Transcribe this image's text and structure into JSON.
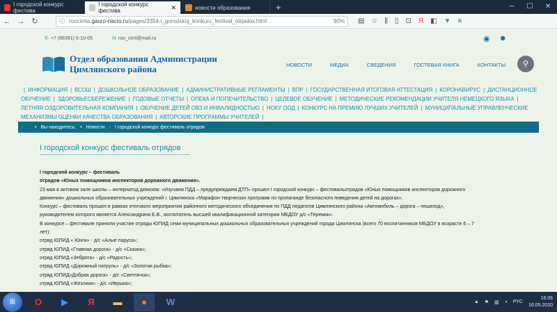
{
  "browser": {
    "tabs": [
      {
        "label": "I городской конкурс фестива",
        "active": false
      },
      {
        "label": "I городской конкурс фестива",
        "active": true
      },
      {
        "label": "новости образования",
        "active": false
      }
    ],
    "url_gray": "roocimla.",
    "url_main": "gauro-riacro.ru",
    "url_path": "/pages/3354-i_gorodskoj_konkurs_festival_otrjadov.html",
    "zoom": "90%"
  },
  "site": {
    "phone": "+7 (86391) 5-10-05",
    "email": "roo_ciml@mail.ru",
    "title_line1": "Отдел образования Администрации",
    "title_line2": "Цимлянского района",
    "nav": [
      "НОВОСТИ",
      "МЕДИА",
      "СВЕДЕНИЯ",
      "ГОСТЕВАЯ КНИГА",
      "КОНТАКТЫ"
    ],
    "topics": [
      "ИНФОРМАЦИЯ",
      "ВсОШ",
      "ДОШКОЛЬНОЕ ОБРАЗОВАНИЕ",
      "АДМИНИСТРАТИВНЫЕ РЕГЛАМЕНТЫ",
      "ВПР",
      "ГОСУДАРСТВЕННАЯ ИТОГОВАЯ АТТЕСТАЦИЯ",
      "КОРОНАВИРУС",
      "ДИСТАНЦИОННОЕ ОБУЧЕНИЕ",
      "ЗДОРОВЬЕСБЕРЕЖЕНИЕ",
      "ГОДОВЫЕ ОТЧЕТЫ",
      "ОПЕКА И ПОПЕЧИТЕЛЬСТВО",
      "ЦЕЛЕВОЕ ОБУЧЕНИЕ",
      "МЕТОДИЧЕСКИЕ РЕКОМЕНДАЦИИ УЧИТЕЛЯ НЕМЕЦКОГО ЯЗЫКА",
      "ЛЕТНЯЯ ОЗДОРОВИТЕЛЬНАЯ КОМПАНИЯ",
      "ОБУЧЕНИЕ ДЕТЕЙ ОВЗ И ИНВАЛИДНОСТЬЮ",
      "НОКУ ООД",
      "КОНКУРС НА ПРЕМИЮ ЛУЧШИХ УЧИТЕЛЕЙ",
      "МУНИЦИПАЛЬНЫЕ УПРАВЛЕНЧЕСКИЕ МЕХАНИЗМЫ ОЦЕНКИ КАЧЕСТВА ОБРАЗОВАНИЯ",
      "АВТОРСКИЕ ПРОГРАММЫ УЧИТЕЛЕЙ"
    ],
    "breadcrumb": [
      "Вы находитесь:",
      "Новости",
      "I городской конкурс фестиваль отрядов"
    ],
    "page_title": "I городской конкурс фестиваль отрядов",
    "article": [
      {
        "text": "I городской конкурс – фестиваль",
        "bold": true
      },
      {
        "text": "отрядов «Юных помощников инспекторов дорожного движения».",
        "bold": true
      },
      {
        "text": "23 мая в актовом зале школы – интернатод девизом: «Изучаем ПДД – предупреждаем ДТП» прошел I городской конкурс – фестивальотрядов «Юных помощников инспекторов дорожного",
        "bold": false
      },
      {
        "text": " движения» дошкольных образовательных учреждений г. Цимлянска «Марафон творческих программ по пропаганде безопасного поведения детей на дорогах».",
        "bold": false
      },
      {
        "text": "Конкурс – фестиваль прошел в рамках итогового мероприятия  районного методического объединения по ПДД педагогов Цимлянского района «Автомобиль – дорога – пешеход»,",
        "bold": false
      },
      {
        "text": "руководителем которого является Александрина Е.В., воспитатель высшей квалификационной категории МБДОУ д/с «Теремок».",
        "bold": false
      },
      {
        "text": "В конкурсе – фестивале приняли участие  отряды ЮПИД семи муниципальных дошкольных образовательных учреждений города Цимлянска (всего 70 воспитанников МБДОУ в возрасте 6 – 7",
        "bold": false
      },
      {
        "text": "лет):",
        "bold": false
      },
      {
        "text": "отряд ЮПИД « Юнги» - д/с  «Алые паруса»;",
        "bold": false
      },
      {
        "text": "отряд ЮПИД «Главная дорога» -  д/с «Сказка»;",
        "bold": false
      },
      {
        "text": "отряд ЮПИД «Зебрята» - д/с «Радость»;",
        "bold": false
      },
      {
        "text": "отряд ЮПИД «Дорожный патруль» - д/с «Золотая рыбка»;",
        "bold": false
      },
      {
        "text": "отряд ЮПИД«Добрая дорога» -  д/с «Светлячок»;",
        "bold": false
      },
      {
        "text": "отряд ЮПИД  «Жезлики» - д/с «Ивушка»;",
        "bold": false
      }
    ]
  },
  "taskbar": {
    "lang": "РУС",
    "time": "16:06",
    "date": "16.05.2020"
  },
  "colors": {
    "accent": "#1a6fa0",
    "crumb_bg": "#0f6d86",
    "page_bg": "#eef3ea"
  }
}
